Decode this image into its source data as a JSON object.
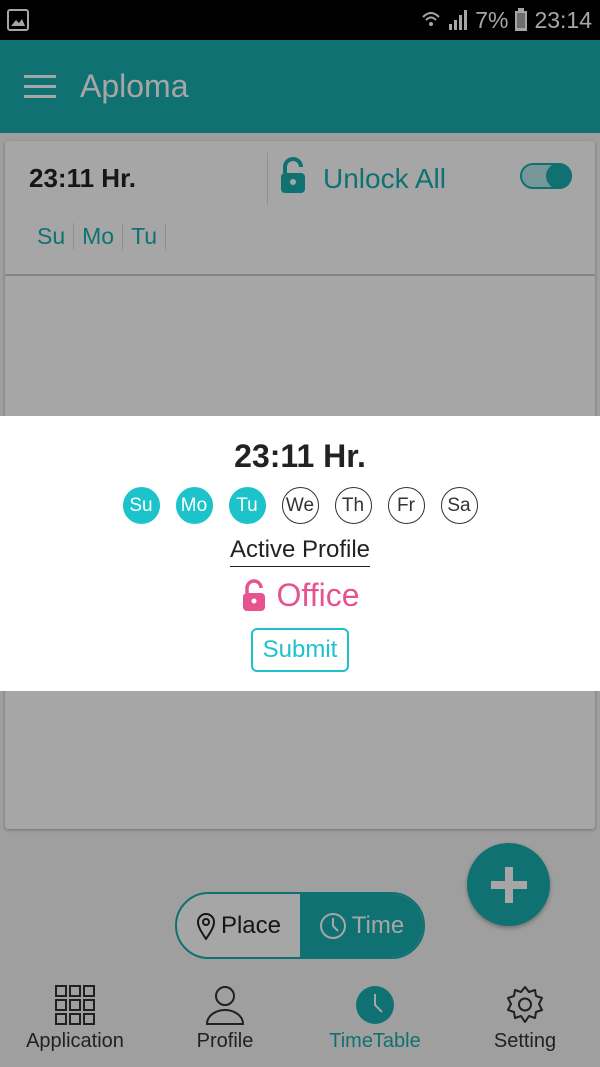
{
  "status_bar": {
    "battery": "7%",
    "time": "23:14"
  },
  "app_bar": {
    "title": "Aploma"
  },
  "card": {
    "time": "23:11 Hr.",
    "unlock_label": "Unlock All",
    "toggle_on": true,
    "days": [
      "Su",
      "Mo",
      "Tu"
    ]
  },
  "segment": {
    "place": "Place",
    "time": "Time"
  },
  "bottom_nav": {
    "application": "Application",
    "profile": "Profile",
    "timetable": "TimeTable",
    "setting": "Setting"
  },
  "dialog": {
    "time": "23:11 Hr.",
    "days": [
      {
        "label": "Su",
        "selected": true
      },
      {
        "label": "Mo",
        "selected": true
      },
      {
        "label": "Tu",
        "selected": true
      },
      {
        "label": "We",
        "selected": false
      },
      {
        "label": "Th",
        "selected": false
      },
      {
        "label": "Fr",
        "selected": false
      },
      {
        "label": "Sa",
        "selected": false
      }
    ],
    "active_profile_label": "Active Profile",
    "profile_name": "Office",
    "submit_label": "Submit"
  },
  "colors": {
    "accent": "#1aaeb1",
    "day_selected": "#1cc3cb",
    "profile": "#e6538f"
  }
}
